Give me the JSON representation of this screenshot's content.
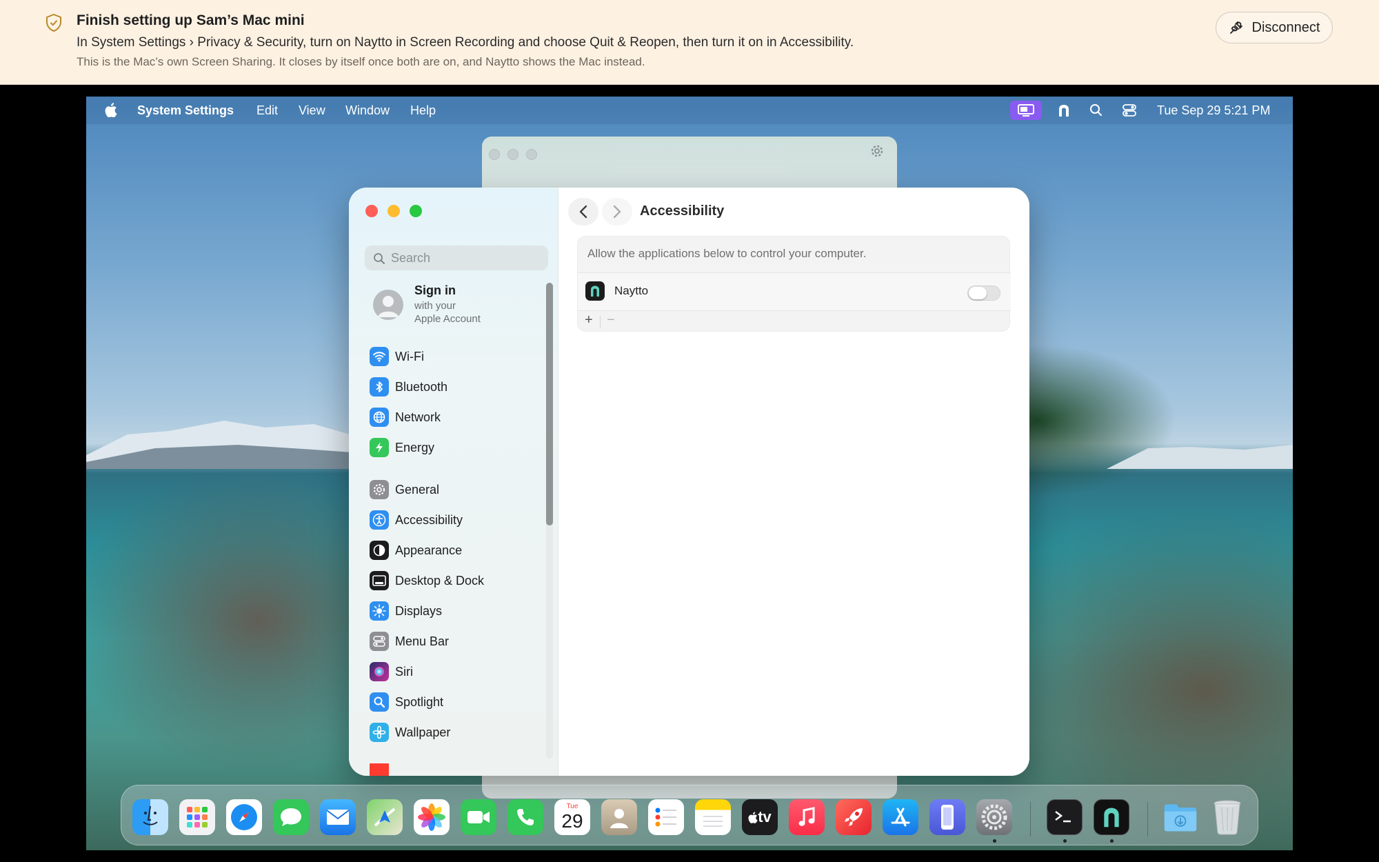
{
  "banner": {
    "title": "Finish setting up Sam’s Mac mini",
    "instruction": "In System Settings › Privacy & Security, turn on Naytto in Screen Recording and choose Quit & Reopen, then turn it on in Accessibility.",
    "note": "This is the Mac’s own Screen Sharing. It closes by itself once both are on, and Naytto shows the Mac instead.",
    "disconnect_label": "Disconnect"
  },
  "menubar": {
    "app_name": "System Settings",
    "menus": [
      "Edit",
      "View",
      "Window",
      "Help"
    ],
    "clock": "Tue Sep 29  5:21 PM"
  },
  "window": {
    "title": "Accessibility",
    "search_placeholder": "Search",
    "account": {
      "title": "Sign in",
      "line1": "with your",
      "line2": "Apple Account"
    },
    "sidebar_group1": [
      "Wi-Fi",
      "Bluetooth",
      "Network",
      "Energy"
    ],
    "sidebar_group2": [
      "General",
      "Accessibility",
      "Appearance",
      "Desktop & Dock",
      "Displays",
      "Menu Bar",
      "Siri",
      "Spotlight",
      "Wallpaper"
    ],
    "panel": {
      "description": "Allow the applications below to control your computer.",
      "apps": [
        {
          "name": "Naytto",
          "enabled": false
        }
      ],
      "add": "+",
      "remove": "−"
    }
  },
  "dock": {
    "calendar_month": "Tue",
    "calendar_day": "29",
    "tv_label": "tv",
    "apps": [
      "Finder",
      "Launchpad",
      "Safari",
      "Messages",
      "Mail",
      "Maps",
      "Photos",
      "FaceTime",
      "Phone",
      "Calendar",
      "Contacts",
      "Reminders",
      "Notes",
      "TV",
      "Music",
      "Rocket",
      "App Store",
      "iPhone Mirroring",
      "System Settings",
      "Terminal",
      "Naytto",
      "Downloads",
      "Trash"
    ]
  },
  "colors": {
    "banner_bg": "#fdf1e2",
    "sharing_indicator": "#8a5bf0",
    "close": "#fe5f57",
    "minimize": "#febc2e",
    "zoom": "#28c840"
  }
}
